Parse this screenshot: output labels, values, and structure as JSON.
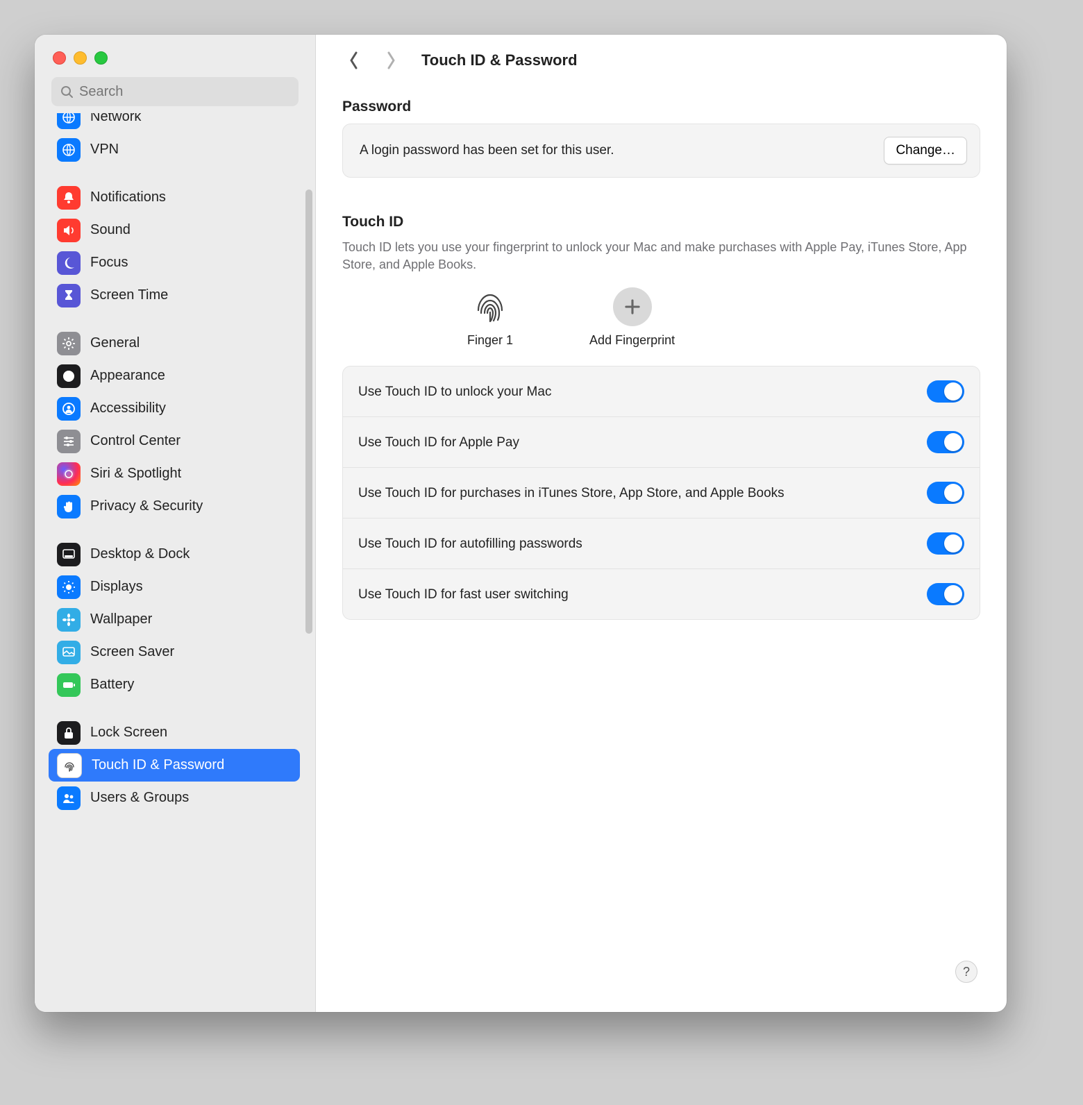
{
  "window": {
    "title": "Touch ID & Password"
  },
  "search": {
    "placeholder": "Search"
  },
  "sidebar": {
    "groups": [
      {
        "items": [
          {
            "id": "network",
            "label": "Network",
            "icon": "globe",
            "color": "blue"
          },
          {
            "id": "vpn",
            "label": "VPN",
            "icon": "globe",
            "color": "blue"
          }
        ]
      },
      {
        "items": [
          {
            "id": "notifications",
            "label": "Notifications",
            "icon": "bell",
            "color": "red"
          },
          {
            "id": "sound",
            "label": "Sound",
            "icon": "speaker",
            "color": "red"
          },
          {
            "id": "focus",
            "label": "Focus",
            "icon": "moon",
            "color": "indigo"
          },
          {
            "id": "screentime",
            "label": "Screen Time",
            "icon": "hourglass",
            "color": "indigo"
          }
        ]
      },
      {
        "items": [
          {
            "id": "general",
            "label": "General",
            "icon": "gear",
            "color": "gray"
          },
          {
            "id": "appearance",
            "label": "Appearance",
            "icon": "contrast",
            "color": "black"
          },
          {
            "id": "accessibility",
            "label": "Accessibility",
            "icon": "person",
            "color": "blue"
          },
          {
            "id": "controlcenter",
            "label": "Control Center",
            "icon": "sliders",
            "color": "gray"
          },
          {
            "id": "siri",
            "label": "Siri & Spotlight",
            "icon": "siri",
            "color": "siri"
          },
          {
            "id": "privacy",
            "label": "Privacy & Security",
            "icon": "hand",
            "color": "blue"
          }
        ]
      },
      {
        "items": [
          {
            "id": "desktop",
            "label": "Desktop & Dock",
            "icon": "dock",
            "color": "black"
          },
          {
            "id": "displays",
            "label": "Displays",
            "icon": "sun",
            "color": "blue"
          },
          {
            "id": "wallpaper",
            "label": "Wallpaper",
            "icon": "flower",
            "color": "sky"
          },
          {
            "id": "screensaver",
            "label": "Screen Saver",
            "icon": "screensaver",
            "color": "sky"
          },
          {
            "id": "battery",
            "label": "Battery",
            "icon": "battery",
            "color": "green"
          }
        ]
      },
      {
        "items": [
          {
            "id": "lockscreen",
            "label": "Lock Screen",
            "icon": "lock",
            "color": "black"
          },
          {
            "id": "touchid",
            "label": "Touch ID & Password",
            "icon": "fingerprint",
            "color": "white",
            "selected": true
          },
          {
            "id": "users",
            "label": "Users & Groups",
            "icon": "users",
            "color": "blue"
          }
        ]
      }
    ]
  },
  "password_section": {
    "heading": "Password",
    "message": "A login password has been set for this user.",
    "change_button": "Change…"
  },
  "touchid_section": {
    "heading": "Touch ID",
    "description": "Touch ID lets you use your fingerprint to unlock your Mac and make purchases with Apple Pay, iTunes Store, App Store, and Apple Books.",
    "fingers": [
      {
        "label": "Finger 1",
        "type": "existing"
      },
      {
        "label": "Add Fingerprint",
        "type": "add"
      }
    ],
    "toggles": [
      {
        "label": "Use Touch ID to unlock your Mac",
        "on": true
      },
      {
        "label": "Use Touch ID for Apple Pay",
        "on": true
      },
      {
        "label": "Use Touch ID for purchases in iTunes Store, App Store, and Apple Books",
        "on": true
      },
      {
        "label": "Use Touch ID for autofilling passwords",
        "on": true
      },
      {
        "label": "Use Touch ID for fast user switching",
        "on": true
      }
    ]
  },
  "help": {
    "label": "?"
  }
}
